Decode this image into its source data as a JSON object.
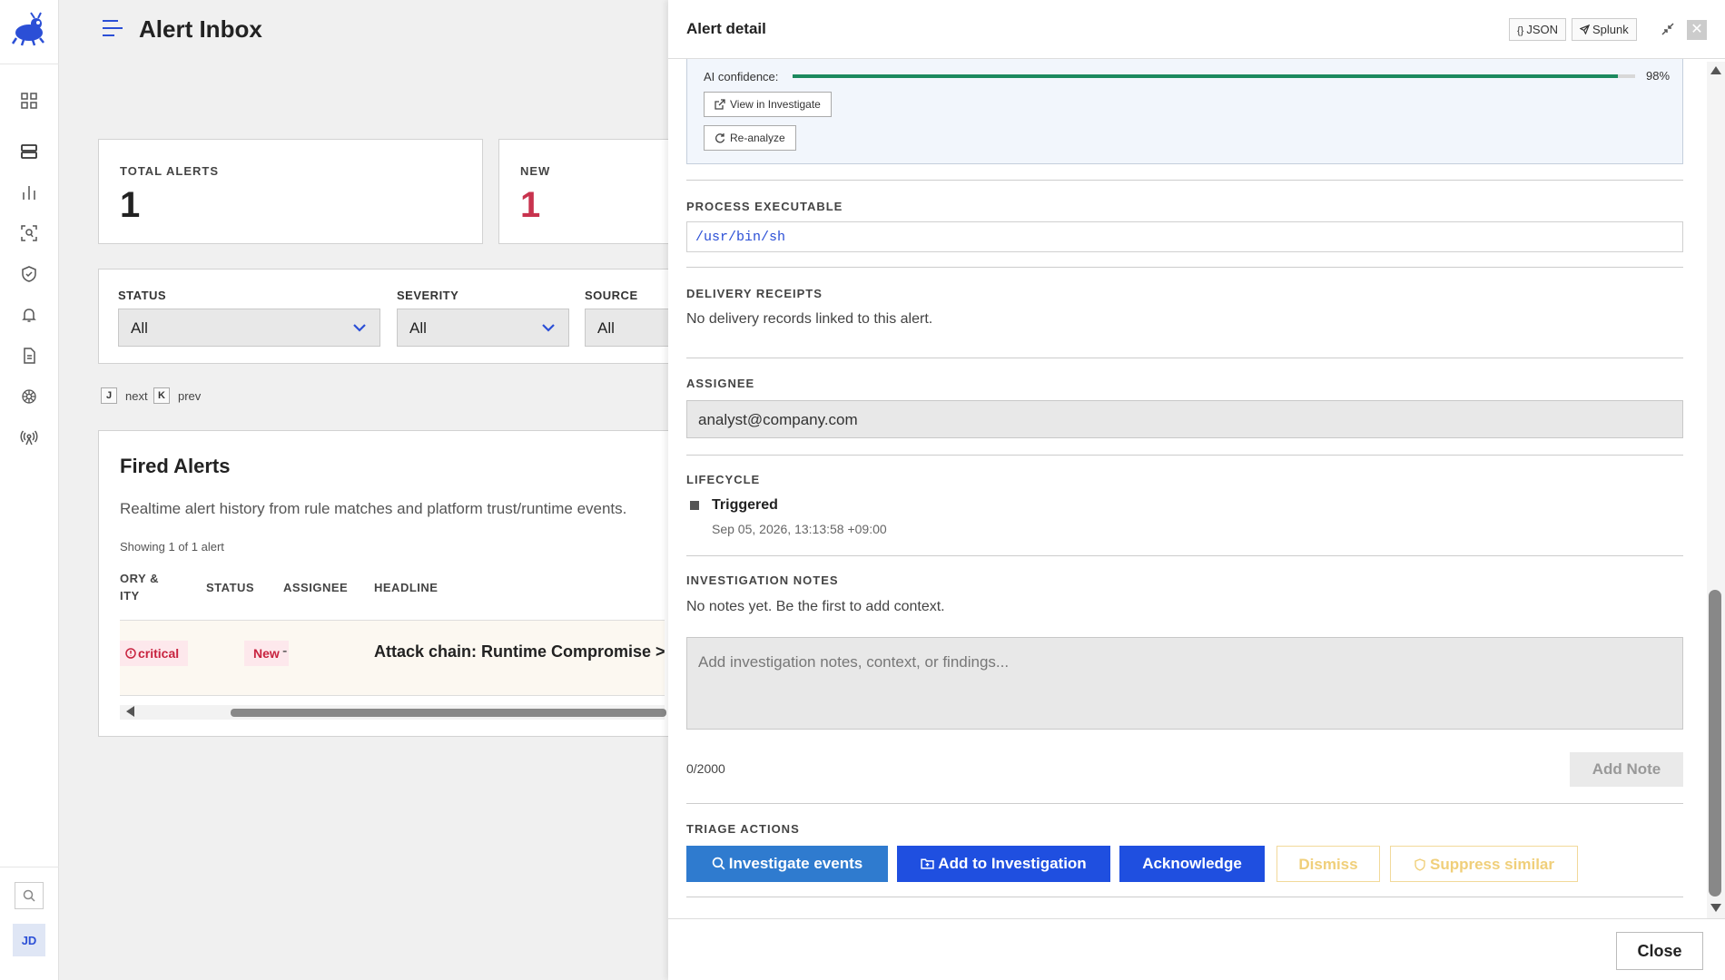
{
  "app": {
    "page_title": "Alert Inbox",
    "avatar_initials": "JD",
    "brand_color": "#2b4fd6"
  },
  "sidebar": {
    "icons": [
      "dashboard-icon",
      "servers-icon",
      "chart-icon",
      "scan-icon",
      "shield-icon",
      "bell-icon",
      "document-icon",
      "gear-network-icon",
      "broadcast-icon"
    ]
  },
  "stats": {
    "total_label": "TOTAL ALERTS",
    "total_value": "1",
    "new_label": "NEW",
    "new_value": "1"
  },
  "filters": {
    "status_label": "STATUS",
    "status_value": "All",
    "severity_label": "SEVERITY",
    "severity_value": "All",
    "source_label": "SOURCE",
    "source_value": "All"
  },
  "shortcuts": {
    "next_key": "J",
    "next_label": "next",
    "prev_key": "K",
    "prev_label": "prev"
  },
  "fired_alerts": {
    "title": "Fired Alerts",
    "description": "Realtime alert history from rule matches and platform trust/runtime events.",
    "showing": "Showing 1 of 1 alert",
    "columns": {
      "category_line1": "ORY &",
      "category_line2": "ITY",
      "status": "STATUS",
      "assignee": "ASSIGNEE",
      "headline": "HEADLINE"
    },
    "row": {
      "severity": "critical",
      "status": "New",
      "assignee": "-",
      "headline": "Attack chain: Runtime Compromise > D"
    }
  },
  "drawer": {
    "title": "Alert detail",
    "json_label": "JSON",
    "splunk_label": "Splunk",
    "ai_confidence_label": "AI confidence:",
    "ai_confidence_value": 0.98,
    "ai_confidence_text": "98%",
    "view_investigate_label": "View in Investigate",
    "reanalyze_label": "Re-analyze",
    "process_label": "PROCESS EXECUTABLE",
    "process_value": "/usr/bin/sh",
    "delivery_label": "DELIVERY RECEIPTS",
    "delivery_text": "No delivery records linked to this alert.",
    "assignee_label": "ASSIGNEE",
    "assignee_value": "analyst@company.com",
    "lifecycle_label": "LIFECYCLE",
    "lifecycle_event": "Triggered",
    "lifecycle_time": "Sep 05, 2026, 13:13:58 +09:00",
    "notes_label": "INVESTIGATION NOTES",
    "notes_empty": "No notes yet. Be the first to add context.",
    "notes_placeholder": "Add investigation notes, context, or findings...",
    "char_count": "0/2000",
    "add_note_label": "Add Note",
    "triage_label": "TRIAGE ACTIONS",
    "investigate_events_label": "Investigate events",
    "add_to_investigation_label": "Add to Investigation",
    "acknowledge_label": "Acknowledge",
    "dismiss_label": "Dismiss",
    "suppress_label": "Suppress similar",
    "close_label": "Close"
  }
}
